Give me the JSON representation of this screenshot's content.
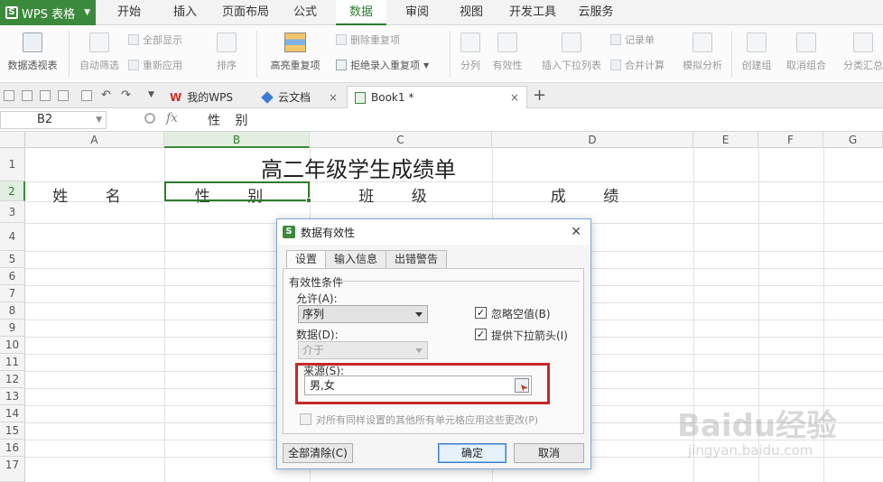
{
  "app": {
    "name": "WPS 表格"
  },
  "menu": [
    "开始",
    "插入",
    "页面布局",
    "公式",
    "数据",
    "审阅",
    "视图",
    "开发工具",
    "云服务"
  ],
  "menu_active": "数据",
  "ribbon": {
    "pivot": "数据透视表",
    "auto_filter": "自动筛选",
    "show_all": "全部显示",
    "reapply": "重新应用",
    "sort": "排序",
    "highlight_dup": "高亮重复项",
    "delete_dup": "删除重复项",
    "reject_dup": "拒绝录入重复项",
    "split": "分列",
    "validity": "有效性",
    "dropdown_list": "插入下拉列表",
    "record": "记录单",
    "merge_calc": "合并计算",
    "simulate": "模拟分析",
    "create_group": "创建组",
    "ungroup": "取消组合",
    "subtotal": "分类汇总"
  },
  "tabs": {
    "my_wps": "我的WPS",
    "cloud_doc": "云文档",
    "book": "Book1 *",
    "add": "+",
    "close": "×"
  },
  "formula_bar": {
    "cell_ref": "B2",
    "fx": "fx",
    "content": "性 别"
  },
  "columns": [
    "A",
    "B",
    "C",
    "D",
    "E",
    "F",
    "G"
  ],
  "rows": [
    "1",
    "2",
    "3",
    "4",
    "5",
    "6",
    "7",
    "8",
    "9",
    "10",
    "11",
    "12",
    "13",
    "14",
    "15",
    "16",
    "17"
  ],
  "sheet": {
    "title": "高二年级学生成绩单",
    "headers": [
      "姓 名",
      "性 别",
      "班 级",
      "成 绩"
    ]
  },
  "dialog": {
    "title": "数据有效性",
    "close": "✕",
    "tabs": [
      "设置",
      "输入信息",
      "出错警告"
    ],
    "group_label": "有效性条件",
    "allow_label": "允许(A):",
    "allow_value": "序列",
    "data_label": "数据(D):",
    "data_value": "介于",
    "ignore_blank": "忽略空值(B)",
    "show_dropdown": "提供下拉箭头(I)",
    "source_label": "来源(S):",
    "source_value": "男,女",
    "apply_all": "对所有同样设置的其他所有单元格应用这些更改(P)",
    "clear_all": "全部清除(C)",
    "ok": "确定",
    "cancel": "取消"
  },
  "watermark": {
    "line1": "Baidu经验",
    "line2": "jingyan.baidu.com"
  }
}
